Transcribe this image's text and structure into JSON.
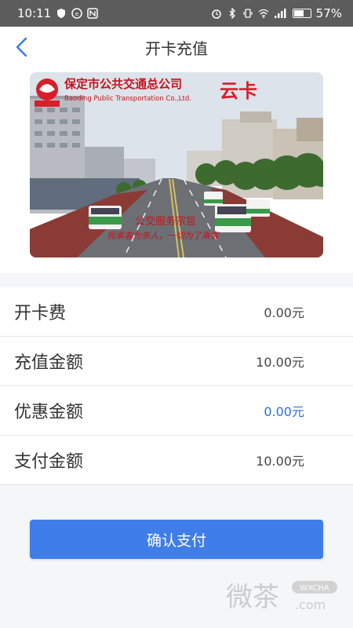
{
  "status_bar": {
    "time": "10:11",
    "battery": "57%"
  },
  "nav": {
    "title": "开卡充值",
    "back_icon": "chevron-left-icon"
  },
  "card": {
    "company_cn": "保定市公共交通总公司",
    "company_en": "Baoding Public Transportation Co.,Ltd.",
    "brand": "云卡",
    "slogan_title": "公交服务宗旨",
    "slogan_text": "视乘客为亲人，一切为了乘客"
  },
  "rows": [
    {
      "label": "开卡费",
      "value": "0.00元"
    },
    {
      "label": "充值金额",
      "value": "10.00元"
    },
    {
      "label": "优惠金额",
      "value": "0.00元"
    },
    {
      "label": "支付金额",
      "value": "10.00元"
    }
  ],
  "pay_button": "确认支付",
  "watermark": {
    "cn": "微茶",
    "badge": "WXCHA",
    "domain": ".com"
  },
  "colors": {
    "accent": "#3f7ee8",
    "discount": "#2f6fd8",
    "status_bar": "#5c5c5c"
  }
}
